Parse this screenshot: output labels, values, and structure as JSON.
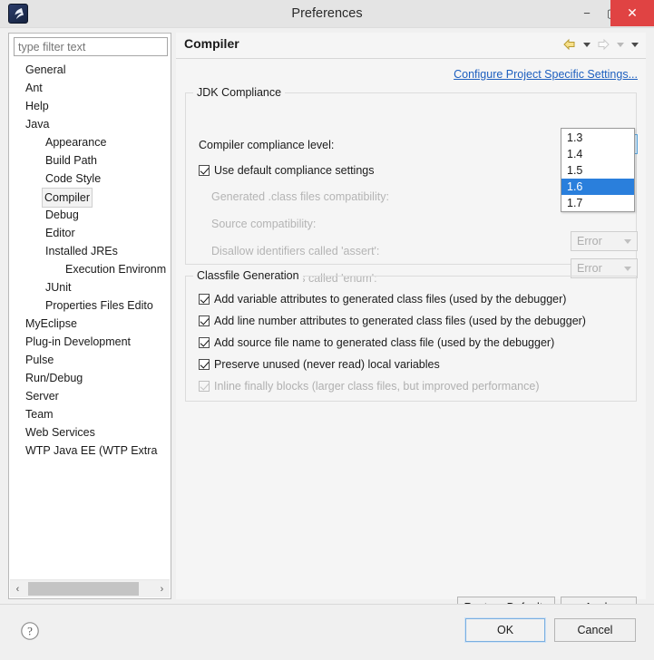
{
  "window": {
    "title": "Preferences",
    "app_icon": "eclipse-icon",
    "minimize": "−",
    "maximize": "▢",
    "close": "✕"
  },
  "sidebar": {
    "filter": {
      "value": "",
      "placeholder": "type filter text"
    },
    "items": [
      {
        "label": "General",
        "indent": 0,
        "selected": false
      },
      {
        "label": "Ant",
        "indent": 0,
        "selected": false
      },
      {
        "label": "Help",
        "indent": 0,
        "selected": false
      },
      {
        "label": "Java",
        "indent": 0,
        "selected": false
      },
      {
        "label": "Appearance",
        "indent": 1,
        "selected": false
      },
      {
        "label": "Build Path",
        "indent": 1,
        "selected": false
      },
      {
        "label": "Code Style",
        "indent": 1,
        "selected": false
      },
      {
        "label": "Compiler",
        "indent": 1,
        "selected": true
      },
      {
        "label": "Debug",
        "indent": 1,
        "selected": false
      },
      {
        "label": "Editor",
        "indent": 1,
        "selected": false
      },
      {
        "label": "Installed JREs",
        "indent": 1,
        "selected": false
      },
      {
        "label": "Execution Environm",
        "indent": 2,
        "selected": false
      },
      {
        "label": "JUnit",
        "indent": 1,
        "selected": false
      },
      {
        "label": "Properties Files Edito",
        "indent": 1,
        "selected": false
      },
      {
        "label": "MyEclipse",
        "indent": 0,
        "selected": false
      },
      {
        "label": "Plug-in Development",
        "indent": 0,
        "selected": false
      },
      {
        "label": "Pulse",
        "indent": 0,
        "selected": false
      },
      {
        "label": "Run/Debug",
        "indent": 0,
        "selected": false
      },
      {
        "label": "Server",
        "indent": 0,
        "selected": false
      },
      {
        "label": "Team",
        "indent": 0,
        "selected": false
      },
      {
        "label": "Web Services",
        "indent": 0,
        "selected": false
      },
      {
        "label": "WTP Java EE (WTP Extra",
        "indent": 0,
        "selected": false
      }
    ],
    "hscroll": {
      "left_arrow": "‹",
      "right_arrow": "›"
    }
  },
  "page": {
    "title": "Compiler",
    "toolbar": {
      "back_icon": "back-arrow-icon",
      "back_menu_icon": "chevron-down-icon",
      "forward_icon": "forward-arrow-icon",
      "forward_menu_icon": "chevron-down-icon",
      "view_menu_icon": "chevron-down-icon"
    },
    "configure_link": "Configure Project Specific Settings..."
  },
  "jdk_compliance": {
    "legend": "JDK Compliance",
    "compliance_level_label": "Compiler compliance level:",
    "compliance_level_value": "1.6",
    "use_default_label": "Use default compliance settings",
    "use_default_checked": true,
    "generated_class_label": "Generated .class files compatibility:",
    "source_compat_label": "Source compatibility:",
    "disallow_assert_label": "Disallow identifiers called 'assert':",
    "disallow_assert_value": "Error",
    "disallow_enum_label": "Disallow identifiers called 'enum':",
    "disallow_enum_value": "Error",
    "dropdown_open": true,
    "dropdown_options": [
      "1.3",
      "1.4",
      "1.5",
      "1.6",
      "1.7"
    ],
    "dropdown_selected": "1.6"
  },
  "classfile_generation": {
    "legend": "Classfile Generation",
    "options": [
      {
        "label": "Add variable attributes to generated class files (used by the debugger)",
        "checked": true,
        "disabled": false
      },
      {
        "label": "Add line number attributes to generated class files (used by the debugger)",
        "checked": true,
        "disabled": false
      },
      {
        "label": "Add source file name to generated class file (used by the debugger)",
        "checked": true,
        "disabled": false
      },
      {
        "label": "Preserve unused (never read) local variables",
        "checked": true,
        "disabled": false
      },
      {
        "label": "Inline finally blocks (larger class files, but improved performance)",
        "checked": true,
        "disabled": true
      }
    ]
  },
  "buttons": {
    "restore_defaults": "Restore Defaults",
    "apply": "Apply",
    "ok": "OK",
    "cancel": "Cancel",
    "help_icon": "help-question-icon"
  },
  "colors": {
    "titlebar": "#e4e4e4",
    "close_button": "#e04343",
    "link": "#1d5fbf",
    "selection": "#2a7fdc",
    "combo_active": "#d7ebfb",
    "panel": "#f5f5f5"
  }
}
